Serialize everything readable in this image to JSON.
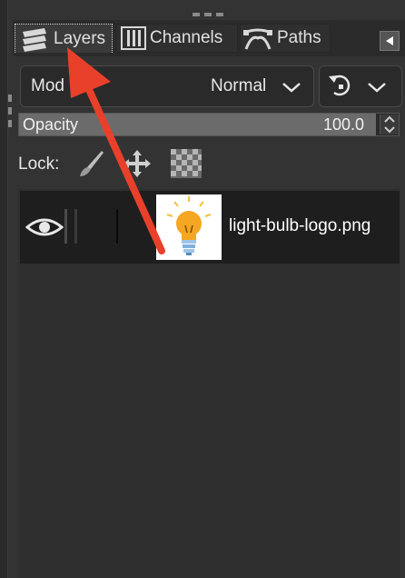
{
  "tabs": [
    {
      "label": "Layers",
      "icon": "layers-icon",
      "active": true
    },
    {
      "label": "Channels",
      "icon": "channels-icon",
      "active": false
    },
    {
      "label": "Paths",
      "icon": "paths-icon",
      "active": false
    }
  ],
  "mode": {
    "label": "Mod",
    "value": "Normal"
  },
  "opacity": {
    "label": "Opacity",
    "value": "100.0"
  },
  "lock": {
    "label": "Lock:"
  },
  "layers": [
    {
      "name": "light-bulb-logo.png",
      "visible": true
    }
  ],
  "colors": {
    "annotation_arrow": "#e8402a",
    "background": "#333333"
  }
}
